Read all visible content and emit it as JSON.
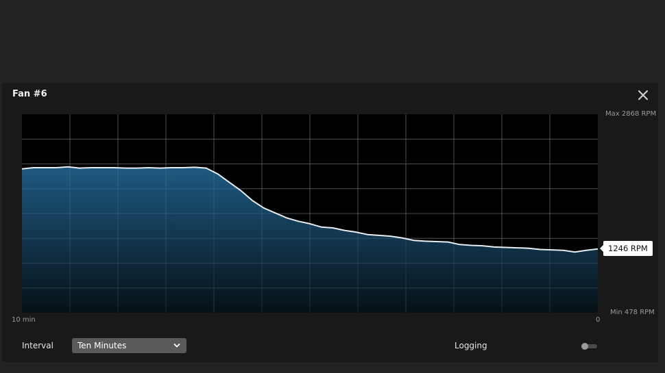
{
  "panel": {
    "title": "Fan #6"
  },
  "icons": {
    "close": "close-icon",
    "chevron": "chevron-down-icon"
  },
  "controls": {
    "interval_label": "Interval",
    "interval_value": "Ten Minutes",
    "logging_label": "Logging",
    "logging_enabled": false
  },
  "colors": {
    "line": "#e8eef3",
    "fill_top": "#1e5a82",
    "fill_bottom": "#061016",
    "grid": "#3a3a3a"
  },
  "chart_data": {
    "type": "area",
    "max_label": "Max 2868 RPM",
    "min_label": "Min 478 RPM",
    "x_start_label": "10 min",
    "x_end_label": "0",
    "current_label": "1246 RPM",
    "ylim": [
      478,
      2868
    ],
    "xlim": [
      10,
      0
    ],
    "grid": true,
    "x_minutes_ago": [
      10,
      9.8,
      9.6,
      9.4,
      9.2,
      9.0,
      8.8,
      8.6,
      8.4,
      8.2,
      8.0,
      7.8,
      7.6,
      7.4,
      7.2,
      7.0,
      6.8,
      6.6,
      6.4,
      6.2,
      6.0,
      5.8,
      5.6,
      5.4,
      5.2,
      5.0,
      4.8,
      4.6,
      4.4,
      4.2,
      4.0,
      3.8,
      3.6,
      3.4,
      3.2,
      3.0,
      2.8,
      2.6,
      2.4,
      2.2,
      2.0,
      1.8,
      1.6,
      1.4,
      1.2,
      1.0,
      0.8,
      0.6,
      0.4,
      0.2,
      0
    ],
    "rpm": [
      2210,
      2225,
      2225,
      2225,
      2235,
      2220,
      2225,
      2225,
      2225,
      2220,
      2220,
      2225,
      2220,
      2225,
      2225,
      2230,
      2220,
      2150,
      2050,
      1950,
      1830,
      1740,
      1680,
      1620,
      1580,
      1550,
      1510,
      1500,
      1470,
      1450,
      1420,
      1410,
      1400,
      1380,
      1350,
      1340,
      1335,
      1330,
      1300,
      1290,
      1285,
      1270,
      1265,
      1260,
      1255,
      1240,
      1235,
      1230,
      1210,
      1230,
      1246
    ]
  }
}
